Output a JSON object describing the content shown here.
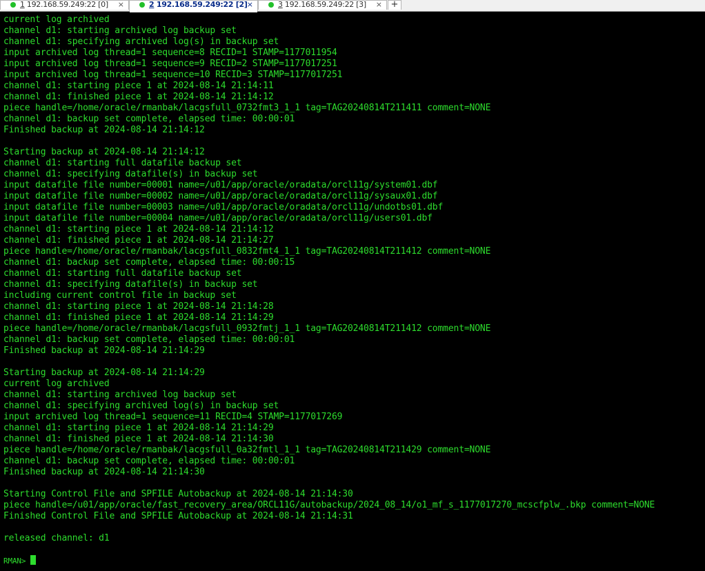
{
  "tabs": [
    {
      "number": "1",
      "title": " 192.168.59.249:22 [0]",
      "close": "×",
      "active": false
    },
    {
      "number": "2",
      "title": " 192.168.59.249:22 [2]",
      "close": "×",
      "active": true
    },
    {
      "number": "3",
      "title": " 192.168.59.249:22 [3]",
      "close": "×",
      "active": false
    }
  ],
  "new_tab_label": "+",
  "terminal": {
    "lines": [
      "current log archived",
      "channel d1: starting archived log backup set",
      "channel d1: specifying archived log(s) in backup set",
      "input archived log thread=1 sequence=8 RECID=1 STAMP=1177011954",
      "input archived log thread=1 sequence=9 RECID=2 STAMP=1177017251",
      "input archived log thread=1 sequence=10 RECID=3 STAMP=1177017251",
      "channel d1: starting piece 1 at 2024-08-14 21:14:11",
      "channel d1: finished piece 1 at 2024-08-14 21:14:12",
      "piece handle=/home/oracle/rmanbak/lacgsfull_0732fmt3_1_1 tag=TAG20240814T211411 comment=NONE",
      "channel d1: backup set complete, elapsed time: 00:00:01",
      "Finished backup at 2024-08-14 21:14:12",
      "",
      "Starting backup at 2024-08-14 21:14:12",
      "channel d1: starting full datafile backup set",
      "channel d1: specifying datafile(s) in backup set",
      "input datafile file number=00001 name=/u01/app/oracle/oradata/orcl11g/system01.dbf",
      "input datafile file number=00002 name=/u01/app/oracle/oradata/orcl11g/sysaux01.dbf",
      "input datafile file number=00003 name=/u01/app/oracle/oradata/orcl11g/undotbs01.dbf",
      "input datafile file number=00004 name=/u01/app/oracle/oradata/orcl11g/users01.dbf",
      "channel d1: starting piece 1 at 2024-08-14 21:14:12",
      "channel d1: finished piece 1 at 2024-08-14 21:14:27",
      "piece handle=/home/oracle/rmanbak/lacgsfull_0832fmt4_1_1 tag=TAG20240814T211412 comment=NONE",
      "channel d1: backup set complete, elapsed time: 00:00:15",
      "channel d1: starting full datafile backup set",
      "channel d1: specifying datafile(s) in backup set",
      "including current control file in backup set",
      "channel d1: starting piece 1 at 2024-08-14 21:14:28",
      "channel d1: finished piece 1 at 2024-08-14 21:14:29",
      "piece handle=/home/oracle/rmanbak/lacgsfull_0932fmtj_1_1 tag=TAG20240814T211412 comment=NONE",
      "channel d1: backup set complete, elapsed time: 00:00:01",
      "Finished backup at 2024-08-14 21:14:29",
      "",
      "Starting backup at 2024-08-14 21:14:29",
      "current log archived",
      "channel d1: starting archived log backup set",
      "channel d1: specifying archived log(s) in backup set",
      "input archived log thread=1 sequence=11 RECID=4 STAMP=1177017269",
      "channel d1: starting piece 1 at 2024-08-14 21:14:29",
      "channel d1: finished piece 1 at 2024-08-14 21:14:30",
      "piece handle=/home/oracle/rmanbak/lacgsfull_0a32fmtl_1_1 tag=TAG20240814T211429 comment=NONE",
      "channel d1: backup set complete, elapsed time: 00:00:01",
      "Finished backup at 2024-08-14 21:14:30",
      "",
      "Starting Control File and SPFILE Autobackup at 2024-08-14 21:14:30",
      "piece handle=/u01/app/oracle/fast_recovery_area/ORCL11G/autobackup/2024_08_14/o1_mf_s_1177017270_mcscfplw_.bkp comment=NONE",
      "Finished Control File and SPFILE Autobackup at 2024-08-14 21:14:31",
      "",
      "released channel: d1",
      ""
    ],
    "prompt": "RMAN> ",
    "text_color": "#2ddc2d",
    "background_color": "#000000"
  }
}
